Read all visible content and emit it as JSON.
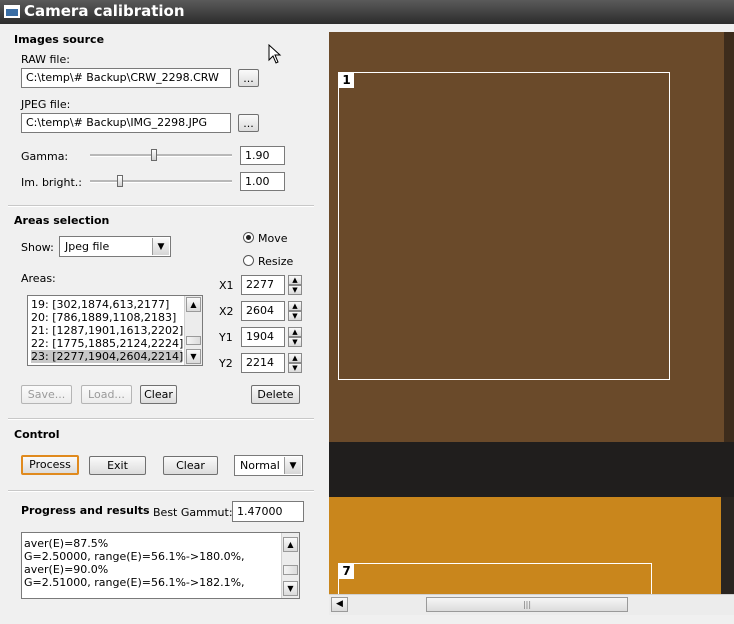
{
  "window": {
    "title": "Camera calibration"
  },
  "images_source": {
    "title": "Images source",
    "raw_label": "RAW file:",
    "raw_value": "C:\\temp\\# Backup\\CRW_2298.CRW",
    "jpeg_label": "JPEG file:",
    "jpeg_value": "C:\\temp\\# Backup\\IMG_2298.JPG",
    "browse_label": "...",
    "gamma_label": "Gamma:",
    "gamma_value": "1.90",
    "bright_label": "Im. bright.:",
    "bright_value": "1.00"
  },
  "areas_selection": {
    "title": "Areas selection",
    "show_label": "Show:",
    "show_value": "Jpeg file",
    "move_label": "Move",
    "resize_label": "Resize",
    "mode_selected": "Move",
    "areas_label": "Areas:",
    "areas": [
      "19: [302,1874,613,2177]",
      "20: [786,1889,1108,2183]",
      "21: [1287,1901,1613,2202]",
      "22: [1775,1885,2124,2224]",
      "23: [2277,1904,2604,2214]"
    ],
    "selected_area": "23: [2277,1904,2604,2214]",
    "x1_label": "X1",
    "x1_value": "2277",
    "x2_label": "X2",
    "x2_value": "2604",
    "y1_label": "Y1",
    "y1_value": "1904",
    "y2_label": "Y2",
    "y2_value": "2214",
    "save_label": "Save...",
    "load_label": "Load...",
    "clear_label": "Clear",
    "delete_label": "Delete"
  },
  "control": {
    "title": "Control",
    "process_label": "Process",
    "exit_label": "Exit",
    "clear_label": "Clear",
    "mode_value": "Normal"
  },
  "progress": {
    "title": "Progress and results",
    "best_gammut_label": "Best Gammut:",
    "best_gammut_value": "1.47000",
    "lines": [
      "aver(E)=87.5%",
      "G=2.50000, range(E)=56.1%->180.0%,",
      "aver(E)=90.0%",
      "G=2.51000, range(E)=56.1%->182.1%,"
    ]
  },
  "viewer": {
    "area_labels": [
      "1",
      "7"
    ],
    "colors": {
      "brown": "#6a4a2a",
      "orange": "#c9861c",
      "dark": "#201e1d"
    }
  }
}
